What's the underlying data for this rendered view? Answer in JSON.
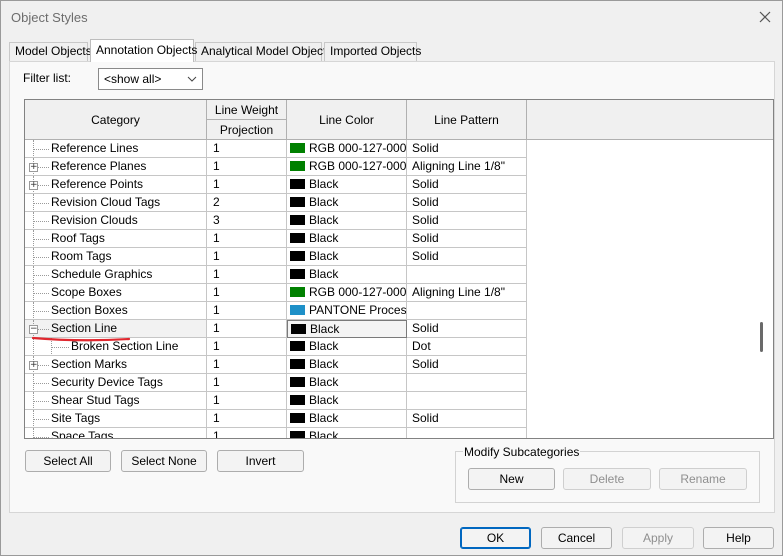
{
  "window": {
    "title": "Object Styles"
  },
  "tabs": [
    {
      "label": "Model Objects",
      "active": false
    },
    {
      "label": "Annotation Objects",
      "active": true
    },
    {
      "label": "Analytical Model Objects",
      "active": false
    },
    {
      "label": "Imported Objects",
      "active": false
    }
  ],
  "filter": {
    "label": "Filter list:",
    "value": "<show all>"
  },
  "grid": {
    "headers": {
      "category": "Category",
      "line_weight": "Line Weight",
      "projection": "Projection",
      "line_color": "Line Color",
      "line_pattern": "Line Pattern"
    },
    "rows": [
      {
        "category": "Reference Lines",
        "weight": "1",
        "color": "RGB 000-127-000",
        "swatch": "#008000",
        "pattern": "Solid"
      },
      {
        "category": "Reference Planes",
        "expander": "+",
        "weight": "1",
        "color": "RGB 000-127-000",
        "swatch": "#008000",
        "pattern": "Aligning Line 1/8\""
      },
      {
        "category": "Reference Points",
        "expander": "+",
        "weight": "1",
        "color": "Black",
        "swatch": "#000000",
        "pattern": "Solid"
      },
      {
        "category": "Revision Cloud Tags",
        "weight": "2",
        "color": "Black",
        "swatch": "#000000",
        "pattern": "Solid"
      },
      {
        "category": "Revision Clouds",
        "weight": "3",
        "color": "Black",
        "swatch": "#000000",
        "pattern": "Solid"
      },
      {
        "category": "Roof Tags",
        "weight": "1",
        "color": "Black",
        "swatch": "#000000",
        "pattern": "Solid"
      },
      {
        "category": "Room Tags",
        "weight": "1",
        "color": "Black",
        "swatch": "#000000",
        "pattern": "Solid"
      },
      {
        "category": "Schedule Graphics",
        "weight": "1",
        "color": "Black",
        "swatch": "#000000",
        "pattern": ""
      },
      {
        "category": "Scope Boxes",
        "weight": "1",
        "color": "RGB 000-127-000",
        "swatch": "#008000",
        "pattern": "Aligning Line 1/8\""
      },
      {
        "category": "Section Boxes",
        "weight": "1",
        "color": "PANTONE Process",
        "swatch": "#1e90c8",
        "pattern": ""
      },
      {
        "category": "Section Line",
        "expander": "−",
        "weight": "1",
        "color": "Black",
        "swatch": "#000000",
        "pattern": "Solid",
        "selected": true
      },
      {
        "category": "Broken Section Line",
        "child": true,
        "weight": "1",
        "color": "Black",
        "swatch": "#000000",
        "pattern": "Dot"
      },
      {
        "category": "Section Marks",
        "expander": "+",
        "weight": "1",
        "color": "Black",
        "swatch": "#000000",
        "pattern": "Solid"
      },
      {
        "category": "Security Device Tags",
        "weight": "1",
        "color": "Black",
        "swatch": "#000000",
        "pattern": ""
      },
      {
        "category": "Shear Stud Tags",
        "weight": "1",
        "color": "Black",
        "swatch": "#000000",
        "pattern": ""
      },
      {
        "category": "Site Tags",
        "weight": "1",
        "color": "Black",
        "swatch": "#000000",
        "pattern": "Solid"
      },
      {
        "category": "Space Tags",
        "weight": "1",
        "color": "Black",
        "swatch": "#000000",
        "pattern": ""
      }
    ]
  },
  "buttons": {
    "select_all": "Select All",
    "select_none": "Select None",
    "invert": "Invert",
    "ok": "OK",
    "cancel": "Cancel",
    "apply": "Apply",
    "help": "Help"
  },
  "modify_subcategories": {
    "label": "Modify Subcategories",
    "new": "New",
    "delete": "Delete",
    "rename": "Rename"
  },
  "colors": {
    "annotation_underline": "#e0282f",
    "default_button_border": "#0067c0"
  }
}
